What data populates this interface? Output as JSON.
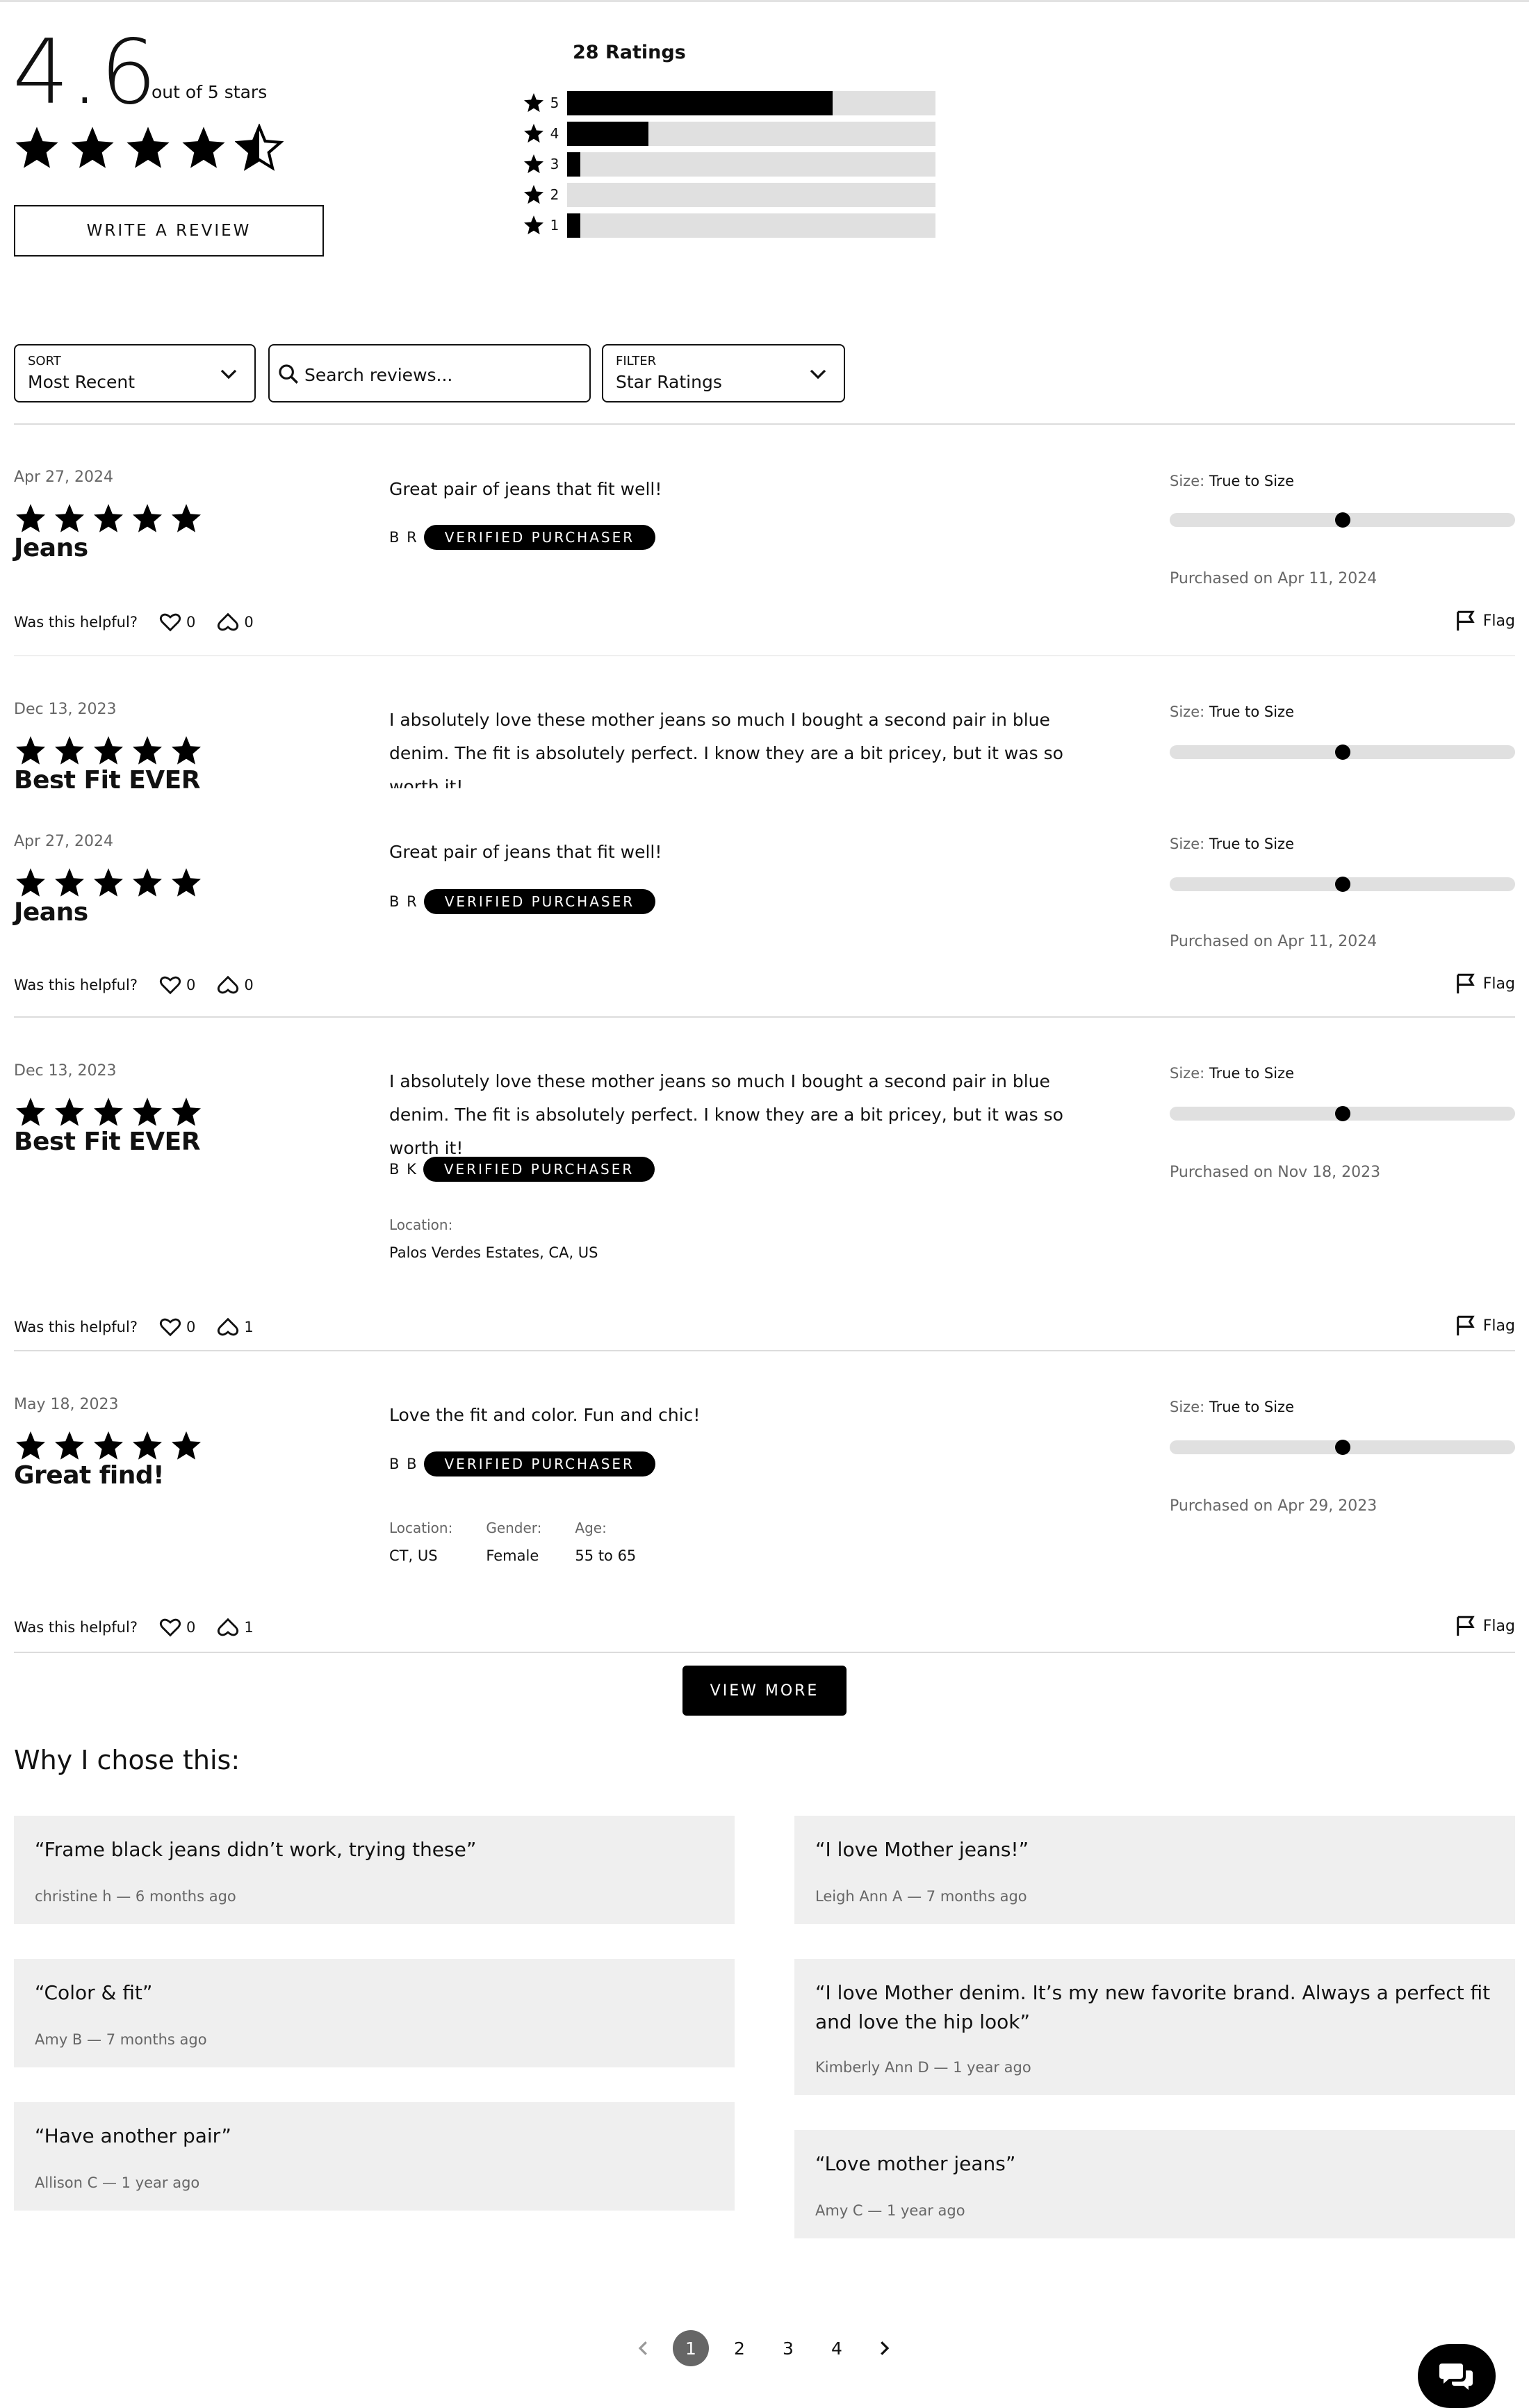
{
  "summary": {
    "average": "4.6",
    "out_of": "out of 5 stars",
    "stars_value": 4.6,
    "ratings_count": "28 Ratings",
    "write_review": "WRITE A REVIEW",
    "histogram": [
      {
        "stars": "5",
        "fraction": 0.72
      },
      {
        "stars": "4",
        "fraction": 0.22
      },
      {
        "stars": "3",
        "fraction": 0.035
      },
      {
        "stars": "2",
        "fraction": 0.0
      },
      {
        "stars": "1",
        "fraction": 0.035
      }
    ]
  },
  "controls": {
    "sort_label": "SORT",
    "sort_value": "Most Recent",
    "search_placeholder": "Search reviews...",
    "filter_label": "FILTER",
    "filter_value": "Star Ratings"
  },
  "reviews": [
    {
      "date": "Apr 27, 2024",
      "rating": 5,
      "title": "Jeans",
      "text": "Great pair of jeans that fit well!",
      "author": "B R",
      "badge": "VERIFIED PURCHASER",
      "size_label": "Size:",
      "size_value": "True to Size",
      "fit_position": 0.5,
      "purchased": "Purchased on Apr 11, 2024",
      "helpful_label": "Was this helpful?",
      "yes": "0",
      "no": "0",
      "flag": "Flag"
    },
    {
      "date": "Dec 13, 2023",
      "rating": 5,
      "title": "Best Fit EVER",
      "text": "I absolutely love these mother jeans so much I bought a second pair in blue denim. The fit is absolutely perfect. I know they are a bit pricey, but it was so worth it!",
      "size_label": "Size:",
      "size_value": "True to Size",
      "fit_position": 0.5
    },
    {
      "date": "Apr 27, 2024",
      "rating": 5,
      "title": "Jeans",
      "text": "Great pair of jeans that fit well!",
      "author": "B R",
      "badge": "VERIFIED PURCHASER",
      "size_label": "Size:",
      "size_value": "True to Size",
      "fit_position": 0.5,
      "purchased": "Purchased on Apr 11, 2024",
      "helpful_label": "Was this helpful?",
      "yes": "0",
      "no": "0",
      "flag": "Flag"
    },
    {
      "date": "Dec 13, 2023",
      "rating": 5,
      "title": "Best Fit EVER",
      "text": "I absolutely love these mother jeans so much I bought a second pair in blue denim. The fit is absolutely perfect. I know they are a bit pricey, but it was so worth it!",
      "author": "B K",
      "badge": "VERIFIED PURCHASER",
      "meta": [
        {
          "label": "Location:",
          "value": "Palos Verdes Estates, CA, US"
        }
      ],
      "size_label": "Size:",
      "size_value": "True to Size",
      "fit_position": 0.5,
      "purchased": "Purchased on Nov 18, 2023",
      "helpful_label": "Was this helpful?",
      "yes": "0",
      "no": "1",
      "flag": "Flag"
    },
    {
      "date": "May 18, 2023",
      "rating": 5,
      "title": "Great find!",
      "text": "Love the fit and color. Fun and chic!",
      "author": "B B",
      "badge": "VERIFIED PURCHASER",
      "meta": [
        {
          "label": "Location:",
          "value": "CT, US"
        },
        {
          "label": "Gender:",
          "value": "Female"
        },
        {
          "label": "Age:",
          "value": "55 to 65"
        }
      ],
      "size_label": "Size:",
      "size_value": "True to Size",
      "fit_position": 0.5,
      "purchased": "Purchased on Apr 29, 2023",
      "helpful_label": "Was this helpful?",
      "yes": "0",
      "no": "1",
      "flag": "Flag"
    }
  ],
  "view_more": "VIEW MORE",
  "why": {
    "title": "Why I chose this:",
    "left": [
      {
        "quote": "“Frame black jeans didn’t work, trying these”",
        "who": "christine h",
        "sep": "—",
        "when": "6 months ago"
      },
      {
        "quote": "“Color & fit”",
        "who": "Amy B",
        "sep": "—",
        "when": "7 months ago"
      },
      {
        "quote": "“Have another pair”",
        "who": "Allison C",
        "sep": "—",
        "when": "1 year ago"
      }
    ],
    "right": [
      {
        "quote": "“I love Mother jeans!”",
        "who": "Leigh Ann A",
        "sep": "—",
        "when": "7 months ago"
      },
      {
        "quote": "“I love Mother denim. It’s my new favorite brand. Always a perfect fit and love the hip look”",
        "who": "Kimberly Ann D",
        "sep": "—",
        "when": "1 year ago"
      },
      {
        "quote": "“Love mother jeans”",
        "who": "Amy C",
        "sep": "—",
        "when": "1 year ago"
      }
    ]
  },
  "pagination": {
    "pages": [
      "1",
      "2",
      "3",
      "4"
    ],
    "current": "1"
  },
  "icons": {
    "star": "star-icon",
    "half_star": "star-half-icon",
    "chevron": "chevron-down-icon",
    "search": "search-icon",
    "heart": "heart-icon",
    "dislike": "dislike-icon",
    "flag": "flag-icon",
    "chat": "chat-icon"
  }
}
